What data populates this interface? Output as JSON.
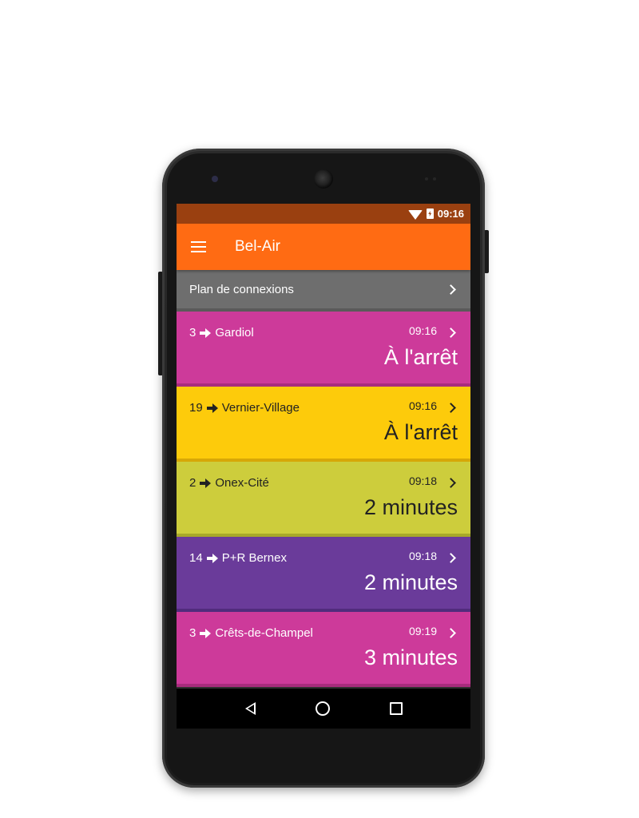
{
  "status_bar": {
    "time": "09:16",
    "color": "#9a4010",
    "icons": [
      "wifi-icon",
      "battery-charging-icon"
    ]
  },
  "app_bar": {
    "title": "Bel-Air",
    "color": "#ff6b13",
    "menu_icon": "menu-icon"
  },
  "connexions": {
    "label": "Plan de connexions",
    "color": "#6e6e6e"
  },
  "departures": [
    {
      "line": "3",
      "destination": "Gardiol",
      "time": "09:16",
      "eta": "À l'arrêt",
      "color": "#cd3a9a",
      "border": "#a82c7d",
      "text_color": "#ffffff"
    },
    {
      "line": "19",
      "destination": "Vernier-Village",
      "time": "09:16",
      "eta": "À l'arrêt",
      "color": "#fdcb0b",
      "border": "#d7a707",
      "text_color": "#222222"
    },
    {
      "line": "2",
      "destination": "Onex-Cité",
      "time": "09:18",
      "eta": "2 minutes",
      "color": "#cdcd3c",
      "border": "#a8a82a",
      "text_color": "#222222"
    },
    {
      "line": "14",
      "destination": "P+R Bernex",
      "time": "09:18",
      "eta": "2 minutes",
      "color": "#6a3b9a",
      "border": "#512c7c",
      "text_color": "#ffffff"
    },
    {
      "line": "3",
      "destination": "Crêts-de-Champel",
      "time": "09:19",
      "eta": "3 minutes",
      "color": "#cd3a9a",
      "border": "#a82c7d",
      "text_color": "#ffffff"
    }
  ],
  "nav_bar": {
    "icons": [
      "back-icon",
      "home-icon",
      "recents-icon"
    ]
  }
}
